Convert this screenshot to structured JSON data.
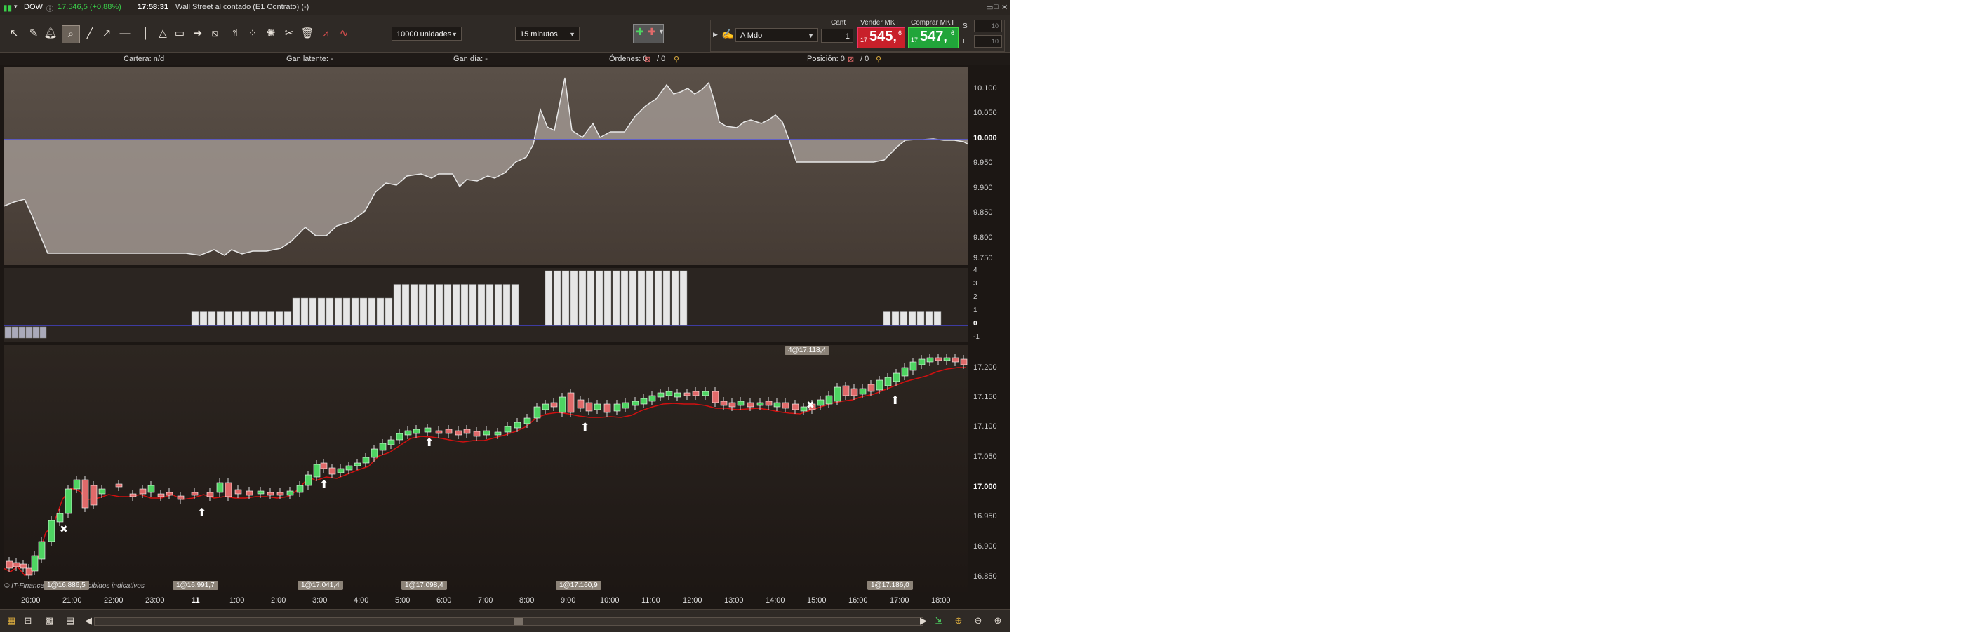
{
  "titlebar": {
    "symbol": "DOW",
    "price": "17.546,5 (+0,88%)",
    "time": "17:58:31",
    "description": "Wall Street al contado (E1 Contrato) (-)",
    "controls": [
      "▭",
      "□",
      "✕"
    ]
  },
  "toolbar": {
    "tools": [
      "cursor-icon",
      "pencil-icon",
      "alert-icon",
      "zoom-icon",
      "line-icon",
      "arrow-line-icon",
      "horizontal-line-icon",
      "vertical-line-icon",
      "triangle-icon",
      "rectangle-icon",
      "arrow-icon",
      "fibonacci-icon",
      "help-text-icon",
      "scatter-icon",
      "magic-icon",
      "tools-icon",
      "trash-icon",
      "indicator-icon",
      "wave-icon"
    ],
    "units_select": "10000 unidades",
    "period_select": "15 minutos",
    "order_type": "A Mdo",
    "qty_label": "Cant",
    "qty_value": "1",
    "sell_label": "Vender MKT",
    "sell_prefix": "17",
    "sell_price": "545,",
    "sell_suffix": "6",
    "buy_label": "Comprar MKT",
    "buy_prefix": "17",
    "buy_price": "547,",
    "buy_suffix": "6",
    "side_s": "S",
    "side_l": "L",
    "side_s_val": "10",
    "side_l_val": "10"
  },
  "infobar": {
    "cartera": "Cartera: n/d",
    "gan_latente": "Gan latente: -",
    "gan_dia": "Gan día: -",
    "ordenes": "Órdenes: 0",
    "ordenes_b": "/ 0",
    "posicion": "Posición: 0",
    "posicion_b": "/ 0"
  },
  "panel1": {
    "ticks": [
      "10.100",
      "10.050",
      "10.000",
      "9.950",
      "9.900",
      "9.850",
      "9.800",
      "9.750"
    ]
  },
  "panel2": {
    "ticks": [
      "4",
      "3",
      "2",
      "1",
      "0",
      "-1"
    ]
  },
  "panel3": {
    "ticks": [
      "17.200",
      "17.150",
      "17.100",
      "17.050",
      "17.000",
      "16.950",
      "16.900",
      "16.850"
    ],
    "tag_top": "4@17.118,4",
    "copyright": "© IT-Finance.com Datos recibidos indicativos",
    "bottom_tags": [
      "1@16.886,5",
      "1@16.991,7",
      "1@17.041,4",
      "1@17.098,4",
      "1@17.160,9",
      "1@17.186,0"
    ]
  },
  "xaxis": [
    "20:00",
    "21:00",
    "22:00",
    "23:00",
    "11",
    "1:00",
    "2:00",
    "3:00",
    "4:00",
    "5:00",
    "6:00",
    "7:00",
    "8:00",
    "9:00",
    "10:00",
    "11:00",
    "12:00",
    "13:00",
    "14:00",
    "15:00",
    "16:00",
    "17:00",
    "18:00"
  ],
  "colors": {
    "up": "#4ed462",
    "down": "#e06a6a",
    "ma": "#d01010",
    "zero_line": "#4444cc"
  }
}
